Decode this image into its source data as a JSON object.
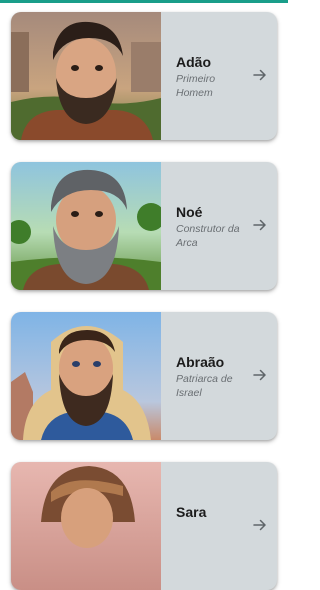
{
  "colors": {
    "accent": "#1a9e8a",
    "card_background": "#d3d9dc",
    "title_text": "#1c1c1c",
    "subtitle_text": "#6a6f73"
  },
  "characters": [
    {
      "name": "Adão",
      "description": "Primeiro Homem",
      "icon": "arrow-right-icon"
    },
    {
      "name": "Noé",
      "description": "Construtor da Arca",
      "icon": "arrow-right-icon"
    },
    {
      "name": "Abraão",
      "description": "Patriarca de Israel",
      "icon": "arrow-right-icon"
    },
    {
      "name": "Sara",
      "description": "",
      "icon": "arrow-right-icon"
    }
  ]
}
